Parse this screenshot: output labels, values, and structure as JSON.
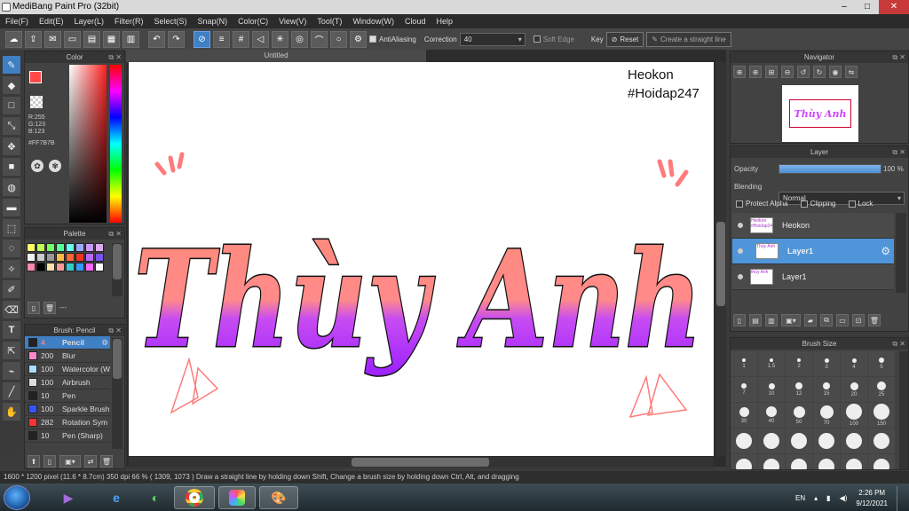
{
  "window": {
    "title": "MediBang Paint Pro (32bit)"
  },
  "menu": [
    "File(F)",
    "Edit(E)",
    "Layer(L)",
    "Filter(R)",
    "Select(S)",
    "Snap(N)",
    "Color(C)",
    "View(V)",
    "Tool(T)",
    "Window(W)",
    "Cloud",
    "Help"
  ],
  "toolbar": {
    "antialiasing": "AntiAliasing",
    "correction_label": "Correction",
    "correction_value": "40",
    "soft_edge": "Soft Edge",
    "key_label": "Key",
    "reset": "Reset",
    "straight_line": "Create a straight line"
  },
  "color_panel": {
    "title": "Color",
    "r": "R:255",
    "g": "G:123",
    "b": "B:123",
    "hex": "#FF7B7B",
    "fg_color": "#ff4a4a"
  },
  "palette_panel": {
    "title": "Palette",
    "swatches": [
      "#ffff66",
      "#bbff55",
      "#77ff66",
      "#55ff99",
      "#66ffee",
      "#99aaff",
      "#cc99ff",
      "#ddaaee",
      "#f2f2f2",
      "#cccccc",
      "#999999",
      "#ffbb44",
      "#ff6633",
      "#ee3322",
      "#bb66ff",
      "#7755ee",
      "#ff88aa",
      "#000000",
      "#ffe0b0",
      "#ff9999",
      "#33cccc",
      "#3399ff",
      "#ff66ff",
      "#ffffff"
    ],
    "footer": "---"
  },
  "brush_panel": {
    "title": "Brush: Pencil",
    "items": [
      {
        "size": "4",
        "name": "Pencil",
        "color": "#222222",
        "selected": true
      },
      {
        "size": "200",
        "name": "Blur",
        "color": "#ff88cc",
        "selected": false
      },
      {
        "size": "100",
        "name": "Watercolor (W",
        "color": "#aaddff",
        "selected": false
      },
      {
        "size": "100",
        "name": "Airbrush",
        "color": "#dddddd",
        "selected": false
      },
      {
        "size": "10",
        "name": "Pen",
        "color": "#222222",
        "selected": false
      },
      {
        "size": "100",
        "name": "Sparkle Brush",
        "color": "#3355ff",
        "selected": false
      },
      {
        "size": "282",
        "name": "Rotation Sym",
        "color": "#ff3333",
        "selected": false
      },
      {
        "size": "10",
        "name": "Pen (Sharp)",
        "color": "#222222",
        "selected": false
      }
    ]
  },
  "canvas": {
    "tab": "Untitled",
    "watermark_line1": "Heokon",
    "watermark_line2": "#Hoidap247",
    "artwork_text": "Thùy Anh"
  },
  "navigator_panel": {
    "title": "Navigator",
    "thumb_text": "Thùy Anh"
  },
  "layer_panel": {
    "title": "Layer",
    "opacity_label": "Opacity",
    "opacity_value": "100 %",
    "opacity_fraction": 1.0,
    "blending_label": "Blending",
    "blending_value": "Normal",
    "protect_alpha": "Protect Alpha",
    "clipping": "Clipping",
    "lock": "Lock",
    "layers": [
      {
        "name": "Heokon",
        "thumb": "Heokon #Hoidap247",
        "selected": false
      },
      {
        "name": "Layer1",
        "thumb": "Thùy Anh",
        "selected": true
      },
      {
        "name": "Layer1",
        "thumb": "thùy Anh",
        "selected": false
      }
    ]
  },
  "brush_size_panel": {
    "title": "Brush Size",
    "sizes": [
      "1",
      "1.5",
      "2",
      "3",
      "4",
      "5",
      "7",
      "10",
      "12",
      "15",
      "20",
      "25",
      "30",
      "40",
      "50",
      "70",
      "100",
      "150"
    ]
  },
  "status": {
    "text": "1600 * 1200 pixel  (11.6 * 8.7cm)  350 dpi  66 %  ( 1309, 1073 )  Draw a straight line by holding down Shift, Change a brush size by holding down Ctrl, Alt, and dragging"
  },
  "taskbar": {
    "lang": "EN",
    "time": "2:26 PM",
    "date": "9/12/2021"
  }
}
